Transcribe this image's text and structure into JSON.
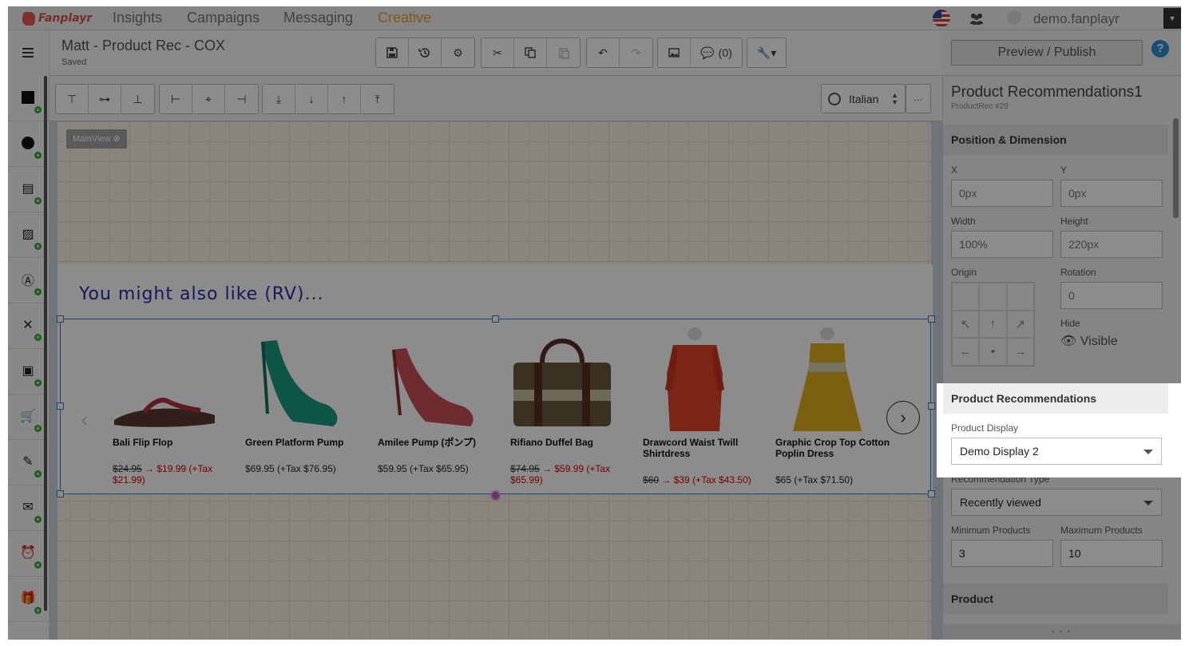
{
  "app": {
    "logo_text": "Fanplayr",
    "nav": [
      {
        "label": "Insights"
      },
      {
        "label": "Campaigns"
      },
      {
        "label": "Messaging"
      },
      {
        "label": "Creative"
      }
    ],
    "account_name": "demo.fanplayr",
    "colors": {
      "accent": "#f0a030",
      "link_blue": "#2f8fd6",
      "selection": "#3a7cc8",
      "heading": "#2b2ba8"
    }
  },
  "document": {
    "title": "Matt - Product Rec - COX",
    "status": "Saved",
    "comments_count": "(0)"
  },
  "toolbar": {
    "preview_label": "Preview / Publish",
    "help_label": "?",
    "language": "Italian",
    "more_label": "..."
  },
  "canvas": {
    "view_tag": "MainView",
    "heading": "You might also like (RV)...",
    "products": [
      {
        "name": "Bali Flip Flop",
        "old_price": "$24.95",
        "price_text": "→ $19.99 (+Tax $21.99)",
        "plain_price": ""
      },
      {
        "name": "Green Platform Pump",
        "old_price": "",
        "price_text": "",
        "plain_price": "$69.95 (+Tax $76.95)"
      },
      {
        "name": "Amilee Pump (ポンプ)",
        "old_price": "",
        "price_text": "",
        "plain_price": "$59.95 (+Tax $65.95)"
      },
      {
        "name": "Rifiano Duffel Bag",
        "old_price": "$74.95",
        "price_text": "→ $59.99 (+Tax $65.99)",
        "plain_price": ""
      },
      {
        "name": "Drawcord Waist Twill Shirtdress",
        "old_price": "$60",
        "price_text": "→ $39 (+Tax $43.50)",
        "plain_price": ""
      },
      {
        "name": "Graphic Crop Top Cotton Poplin Dress",
        "old_price": "",
        "price_text": "",
        "plain_price": "$65 (+Tax $71.50)"
      }
    ]
  },
  "panel": {
    "title": "Product Recommendations1",
    "subtitle": "ProductRec #29",
    "position_section": "Position & Dimension",
    "x_label": "X",
    "x_value": "0px",
    "y_label": "Y",
    "y_value": "0px",
    "width_label": "Width",
    "width_value": "100%",
    "height_label": "Height",
    "height_value": "220px",
    "origin_label": "Origin",
    "rotation_label": "Rotation",
    "rotation_value": "0",
    "hide_label": "Hide",
    "hide_value": "Visible",
    "recs_section": "Product Recommendations",
    "display_label": "Product Display",
    "display_value": "Demo Display 2",
    "type_label": "Recommendation Type",
    "type_value": "Recently viewed",
    "min_label": "Minimum Products",
    "min_value": "3",
    "max_label": "Maximum Products",
    "max_value": "10",
    "product_section": "Product",
    "footer": "• • •"
  }
}
